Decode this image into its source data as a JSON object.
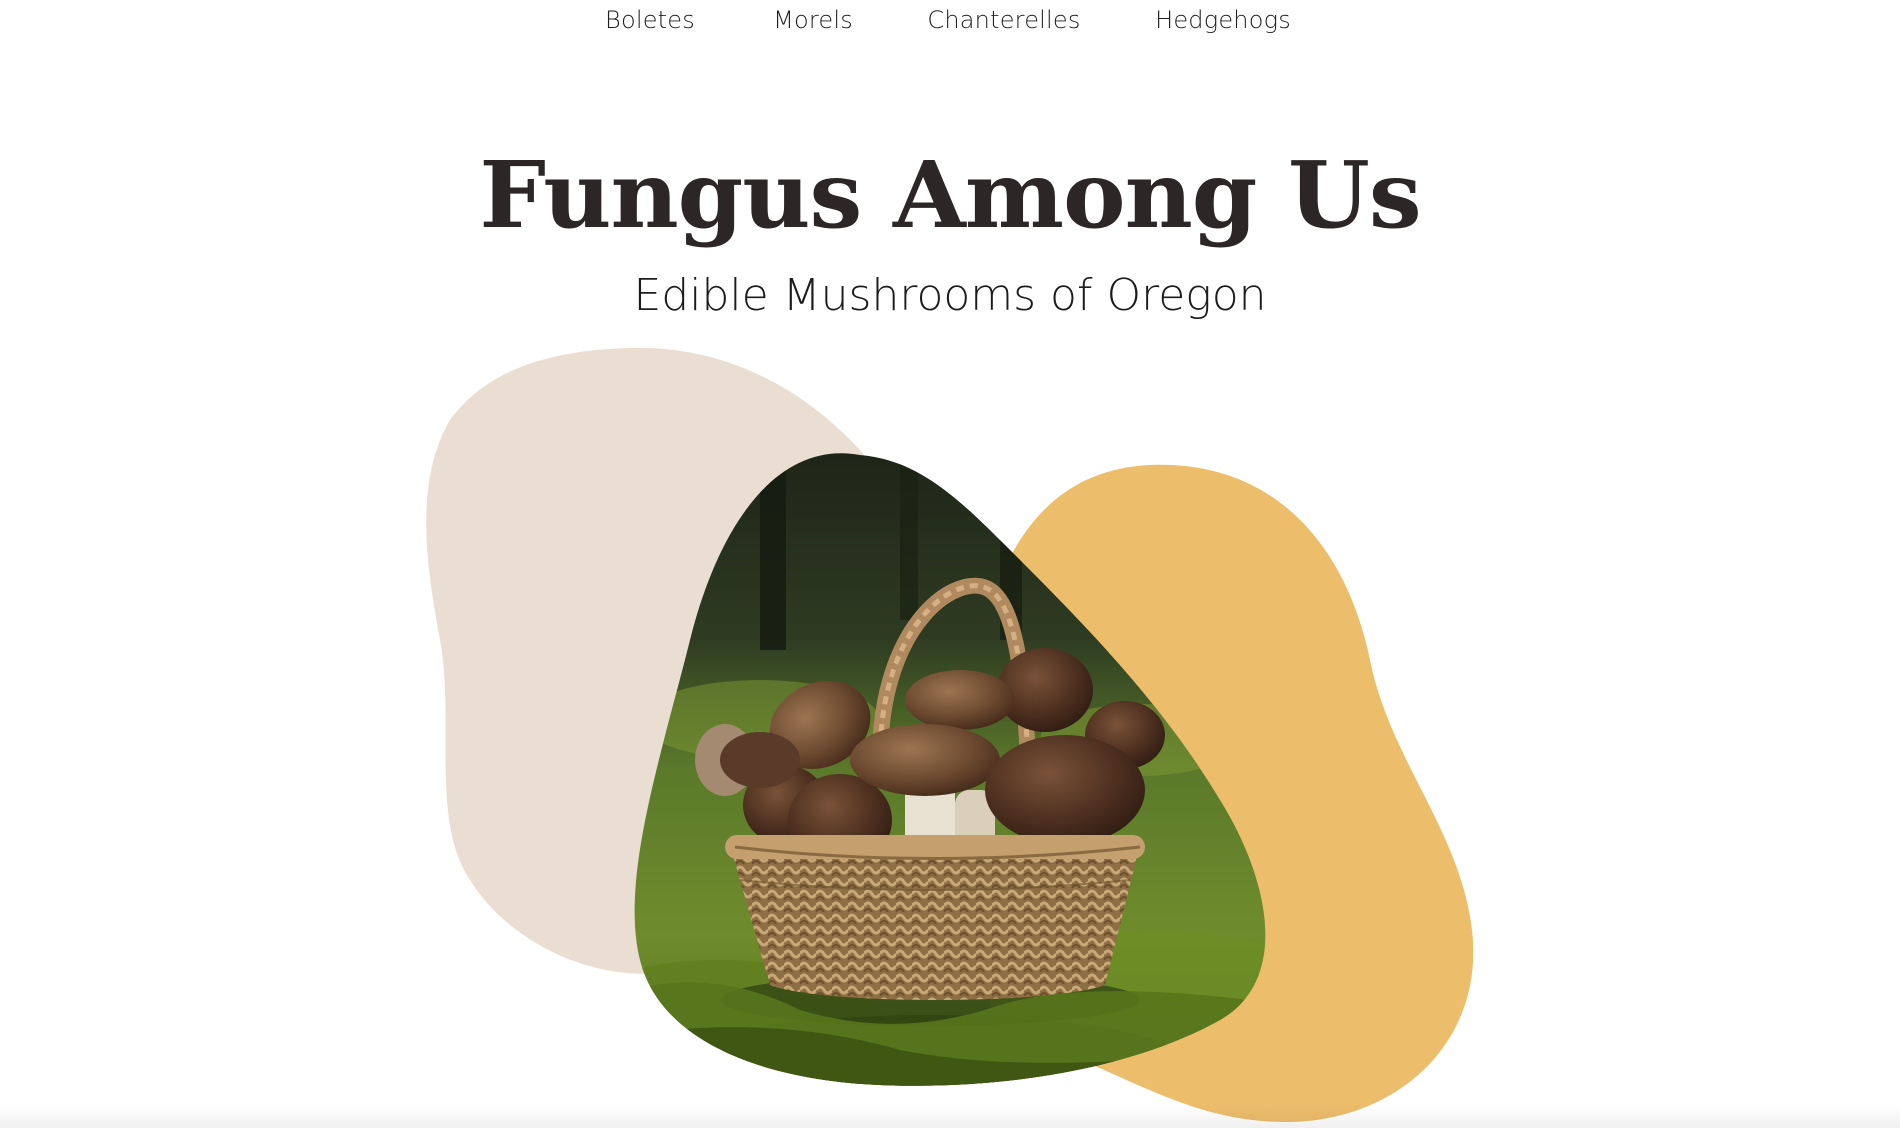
{
  "nav": {
    "items": [
      {
        "label": "Boletes"
      },
      {
        "label": "Morels"
      },
      {
        "label": "Chanterelles"
      },
      {
        "label": "Hedgehogs"
      }
    ]
  },
  "hero": {
    "title": "Fungus Among Us",
    "subtitle": "Edible Mushrooms of Oregon",
    "image_subject": "wicker basket of porcini mushrooms on mossy forest floor"
  },
  "colors": {
    "background": "#ffffff",
    "title": "#2d2627",
    "blob_beige": "#eaddd2",
    "blob_gold": "#ecbd6b",
    "moss": "#6f8c2c",
    "basket": "#a8865a",
    "mushroom_cap": "#5a3a2a"
  }
}
